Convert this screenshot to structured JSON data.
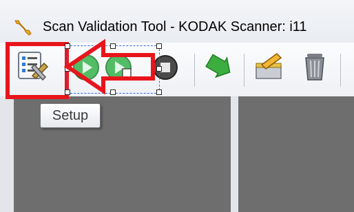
{
  "window": {
    "title": "Scan Validation Tool - KODAK Scanner: i11"
  },
  "toolbar": {
    "buttons": [
      "setup",
      "start-scan",
      "scan-one-page",
      "stop",
      "transfer",
      "edit",
      "delete"
    ]
  },
  "tooltip": {
    "text": "Setup"
  },
  "colors": {
    "highlight": "#e8151c",
    "selection": "#3a66d8",
    "panel": "#6e6e6e"
  }
}
